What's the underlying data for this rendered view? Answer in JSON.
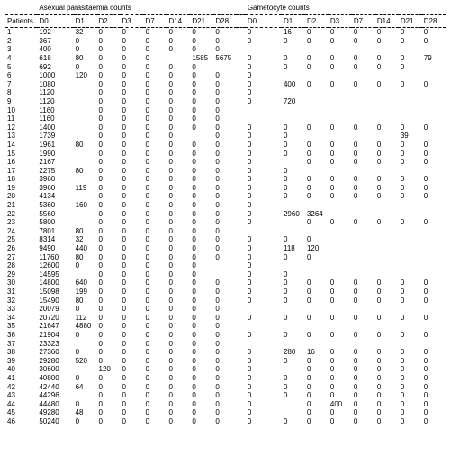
{
  "groups": {
    "left": "Asexual parasitaemia counts",
    "right": "Gametocyte counts"
  },
  "cols": {
    "patients": "Patients",
    "days": [
      "D0",
      "D1",
      "D2",
      "D3",
      "D7",
      "D14",
      "D21",
      "D28"
    ]
  },
  "rows": [
    {
      "p": "1",
      "a": [
        "192",
        "32",
        "0",
        "0",
        "0",
        "0",
        "0",
        "0"
      ],
      "g": [
        "0",
        "16",
        "0",
        "0",
        "0",
        "0",
        "0",
        "0"
      ]
    },
    {
      "p": "2",
      "a": [
        "367",
        "0",
        "0",
        "0",
        "0",
        "0",
        "0",
        "0"
      ],
      "g": [
        "0",
        "0",
        "0",
        "0",
        "0",
        "0",
        "0",
        "0"
      ]
    },
    {
      "p": "3",
      "a": [
        "400",
        "0",
        "0",
        "0",
        "0",
        "0",
        "0",
        "0"
      ],
      "g": [
        "",
        "",
        "",
        "",
        "",
        "",
        "",
        ""
      ]
    },
    {
      "p": "4",
      "a": [
        "618",
        "80",
        "0",
        "0",
        "0",
        "",
        "1585",
        "5675"
      ],
      "g": [
        "0",
        "0",
        "0",
        "0",
        "0",
        "0",
        "0",
        "79"
      ]
    },
    {
      "p": "5",
      "a": [
        "692",
        "0",
        "0",
        "0",
        "0",
        "0",
        "0",
        ""
      ],
      "g": [
        "0",
        "0",
        "0",
        "0",
        "0",
        "0",
        "0",
        ""
      ]
    },
    {
      "p": "6",
      "a": [
        "1000",
        "120",
        "0",
        "0",
        "0",
        "0",
        "0",
        "0"
      ],
      "g": [
        "0",
        "",
        "",
        "",
        "",
        "",
        "",
        ""
      ]
    },
    {
      "p": "7",
      "a": [
        "1080",
        "",
        "0",
        "0",
        "0",
        "0",
        "0",
        "0"
      ],
      "g": [
        "0",
        "400",
        "0",
        "0",
        "0",
        "0",
        "0",
        "0"
      ]
    },
    {
      "p": "8",
      "a": [
        "1120",
        "",
        "0",
        "0",
        "0",
        "0",
        "0",
        "0"
      ],
      "g": [
        "0",
        "",
        "",
        "",
        "",
        "",
        "",
        ""
      ]
    },
    {
      "p": "9",
      "a": [
        "1120",
        "",
        "0",
        "0",
        "0",
        "0",
        "0",
        "0"
      ],
      "g": [
        "0",
        "720",
        "",
        "",
        "",
        "",
        "",
        ""
      ]
    },
    {
      "p": "10",
      "a": [
        "1160",
        "",
        "0",
        "0",
        "0",
        "0",
        "0",
        "0"
      ],
      "g": [
        "",
        "",
        "",
        "",
        "",
        "",
        "",
        ""
      ]
    },
    {
      "p": "11",
      "a": [
        "1160",
        "",
        "0",
        "0",
        "0",
        "0",
        "0",
        "0"
      ],
      "g": [
        "",
        "",
        "",
        "",
        "",
        "",
        "",
        ""
      ]
    },
    {
      "p": "12",
      "a": [
        "1400",
        "",
        "0",
        "0",
        "0",
        "0",
        "0",
        "0"
      ],
      "g": [
        "0",
        "0",
        "0",
        "0",
        "0",
        "0",
        "0",
        "0"
      ]
    },
    {
      "p": "13",
      "a": [
        "1739",
        "",
        "0",
        "0",
        "0",
        "0",
        "",
        "0"
      ],
      "g": [
        "0",
        "0",
        "",
        "",
        "",
        "",
        "39",
        ""
      ]
    },
    {
      "p": "14",
      "a": [
        "1961",
        "80",
        "0",
        "0",
        "0",
        "0",
        "0",
        "0"
      ],
      "g": [
        "0",
        "0",
        "0",
        "0",
        "0",
        "0",
        "0",
        "0"
      ]
    },
    {
      "p": "15",
      "a": [
        "1990",
        "",
        "0",
        "0",
        "0",
        "0",
        "0",
        "0"
      ],
      "g": [
        "0",
        "0",
        "0",
        "0",
        "0",
        "0",
        "0",
        "0"
      ]
    },
    {
      "p": "16",
      "a": [
        "2167",
        "",
        "0",
        "0",
        "0",
        "0",
        "0",
        "0"
      ],
      "g": [
        "0",
        "",
        "0",
        "0",
        "0",
        "0",
        "0",
        "0"
      ]
    },
    {
      "p": "17",
      "a": [
        "2275",
        "80",
        "0",
        "0",
        "0",
        "0",
        "0",
        "0"
      ],
      "g": [
        "0",
        "0",
        "",
        "",
        "",
        "",
        "",
        ""
      ]
    },
    {
      "p": "18",
      "a": [
        "3960",
        "",
        "0",
        "0",
        "0",
        "0",
        "0",
        "0"
      ],
      "g": [
        "0",
        "0",
        "0",
        "0",
        "0",
        "0",
        "0",
        "0"
      ]
    },
    {
      "p": "19",
      "a": [
        "3960",
        "119",
        "0",
        "0",
        "0",
        "0",
        "0",
        "0"
      ],
      "g": [
        "0",
        "0",
        "0",
        "0",
        "0",
        "0",
        "0",
        "0"
      ]
    },
    {
      "p": "20",
      "a": [
        "4134",
        "",
        "0",
        "0",
        "0",
        "0",
        "0",
        "0"
      ],
      "g": [
        "0",
        "0",
        "0",
        "0",
        "0",
        "0",
        "0",
        "0"
      ]
    },
    {
      "p": "21",
      "a": [
        "5360",
        "160",
        "0",
        "0",
        "0",
        "0",
        "0",
        "0"
      ],
      "g": [
        "0",
        "",
        "",
        "",
        "",
        "",
        "",
        ""
      ]
    },
    {
      "p": "22",
      "a": [
        "5560",
        "",
        "0",
        "0",
        "0",
        "0",
        "0",
        "0"
      ],
      "g": [
        "0",
        "2960",
        "3264",
        "",
        "",
        "",
        "",
        ""
      ]
    },
    {
      "p": "23",
      "a": [
        "5800",
        "",
        "0",
        "0",
        "0",
        "0",
        "0",
        "0"
      ],
      "g": [
        "0",
        "",
        "0",
        "0",
        "0",
        "0",
        "0",
        "0"
      ]
    },
    {
      "p": "24",
      "a": [
        "7801",
        "80",
        "0",
        "0",
        "0",
        "0",
        "0",
        "0"
      ],
      "g": [
        "",
        "",
        "",
        "",
        "",
        "",
        "",
        ""
      ]
    },
    {
      "p": "25",
      "a": [
        "8314",
        "32",
        "0",
        "0",
        "0",
        "0",
        "0",
        "0"
      ],
      "g": [
        "0",
        "0",
        "0",
        "",
        "",
        "",
        "",
        ""
      ]
    },
    {
      "p": "26",
      "a": [
        "9490",
        "440",
        "0",
        "0",
        "0",
        "0",
        "0",
        "0"
      ],
      "g": [
        "0",
        "118",
        "120",
        "",
        "",
        "",
        "",
        ""
      ]
    },
    {
      "p": "27",
      "a": [
        "11760",
        "80",
        "0",
        "0",
        "0",
        "0",
        "0",
        "0"
      ],
      "g": [
        "0",
        "0",
        "0",
        "",
        "",
        "",
        "",
        ""
      ]
    },
    {
      "p": "28",
      "a": [
        "12600",
        "0",
        "0",
        "0",
        "0",
        "0",
        "0",
        ""
      ],
      "g": [
        "0",
        "",
        "",
        "",
        "",
        "",
        "",
        ""
      ]
    },
    {
      "p": "29",
      "a": [
        "14595",
        "",
        "0",
        "0",
        "0",
        "0",
        "0",
        ""
      ],
      "g": [
        "0",
        "0",
        "",
        "",
        "",
        "",
        "",
        ""
      ]
    },
    {
      "p": "30",
      "a": [
        "14800",
        "640",
        "0",
        "0",
        "0",
        "0",
        "0",
        "0"
      ],
      "g": [
        "0",
        "0",
        "0",
        "0",
        "0",
        "0",
        "0",
        "0"
      ]
    },
    {
      "p": "31",
      "a": [
        "15098",
        "199",
        "0",
        "0",
        "0",
        "0",
        "0",
        "0"
      ],
      "g": [
        "0",
        "0",
        "0",
        "0",
        "0",
        "0",
        "0",
        "0"
      ]
    },
    {
      "p": "32",
      "a": [
        "15490",
        "80",
        "0",
        "0",
        "0",
        "0",
        "0",
        "0"
      ],
      "g": [
        "0",
        "0",
        "0",
        "0",
        "0",
        "0",
        "0",
        "0"
      ]
    },
    {
      "p": "33",
      "a": [
        "20079",
        "0",
        "0",
        "0",
        "0",
        "0",
        "0",
        "0"
      ],
      "g": [
        "",
        "",
        "",
        "",
        "",
        "",
        "",
        ""
      ]
    },
    {
      "p": "34",
      "a": [
        "20720",
        "112",
        "0",
        "0",
        "0",
        "0",
        "0",
        "0"
      ],
      "g": [
        "0",
        "0",
        "0",
        "0",
        "0",
        "0",
        "0",
        "0"
      ]
    },
    {
      "p": "35",
      "a": [
        "21647",
        "4880",
        "0",
        "0",
        "0",
        "0",
        "0",
        "0"
      ],
      "g": [
        "",
        "",
        "",
        "",
        "",
        "",
        "",
        ""
      ]
    },
    {
      "p": "36",
      "a": [
        "21904",
        "0",
        "0",
        "0",
        "0",
        "0",
        "0",
        "0"
      ],
      "g": [
        "0",
        "0",
        "0",
        "0",
        "0",
        "0",
        "0",
        "0"
      ]
    },
    {
      "p": "37",
      "a": [
        "23323",
        "",
        "0",
        "0",
        "0",
        "0",
        "0",
        "0"
      ],
      "g": [
        "",
        "",
        "",
        "",
        "",
        "",
        "",
        ""
      ]
    },
    {
      "p": "38",
      "a": [
        "27360",
        "0",
        "0",
        "0",
        "0",
        "0",
        "0",
        "0"
      ],
      "g": [
        "0",
        "280",
        "16",
        "0",
        "0",
        "0",
        "0",
        "0"
      ]
    },
    {
      "p": "39",
      "a": [
        "29280",
        "520",
        "0",
        "0",
        "0",
        "0",
        "0",
        "0"
      ],
      "g": [
        "0",
        "0",
        "0",
        "0",
        "0",
        "0",
        "0",
        "0"
      ]
    },
    {
      "p": "40",
      "a": [
        "30600",
        "",
        "120",
        "0",
        "0",
        "0",
        "0",
        "0"
      ],
      "g": [
        "0",
        "",
        "0",
        "0",
        "0",
        "0",
        "0",
        "0"
      ]
    },
    {
      "p": "41",
      "a": [
        "40800",
        "0",
        "0",
        "0",
        "0",
        "0",
        "0",
        "0"
      ],
      "g": [
        "0",
        "0",
        "0",
        "0",
        "0",
        "0",
        "0",
        "0"
      ]
    },
    {
      "p": "42",
      "a": [
        "42440",
        "64",
        "0",
        "0",
        "0",
        "0",
        "0",
        "0"
      ],
      "g": [
        "0",
        "0",
        "0",
        "0",
        "0",
        "0",
        "0",
        "0"
      ]
    },
    {
      "p": "43",
      "a": [
        "44296",
        "",
        "0",
        "0",
        "0",
        "0",
        "0",
        "0"
      ],
      "g": [
        "0",
        "0",
        "0",
        "0",
        "0",
        "0",
        "0",
        "0"
      ]
    },
    {
      "p": "44",
      "a": [
        "44480",
        "0",
        "0",
        "0",
        "0",
        "0",
        "0",
        "0"
      ],
      "g": [
        "0",
        "",
        "0",
        "400",
        "0",
        "0",
        "0",
        "0"
      ]
    },
    {
      "p": "45",
      "a": [
        "49280",
        "48",
        "0",
        "0",
        "0",
        "0",
        "0",
        "0"
      ],
      "g": [
        "0",
        "",
        "0",
        "0",
        "0",
        "0",
        "0",
        "0"
      ]
    },
    {
      "p": "46",
      "a": [
        "50240",
        "0",
        "0",
        "0",
        "0",
        "0",
        "0",
        "0"
      ],
      "g": [
        "0",
        "0",
        "0",
        "0",
        "0",
        "0",
        "0",
        "0"
      ]
    }
  ]
}
